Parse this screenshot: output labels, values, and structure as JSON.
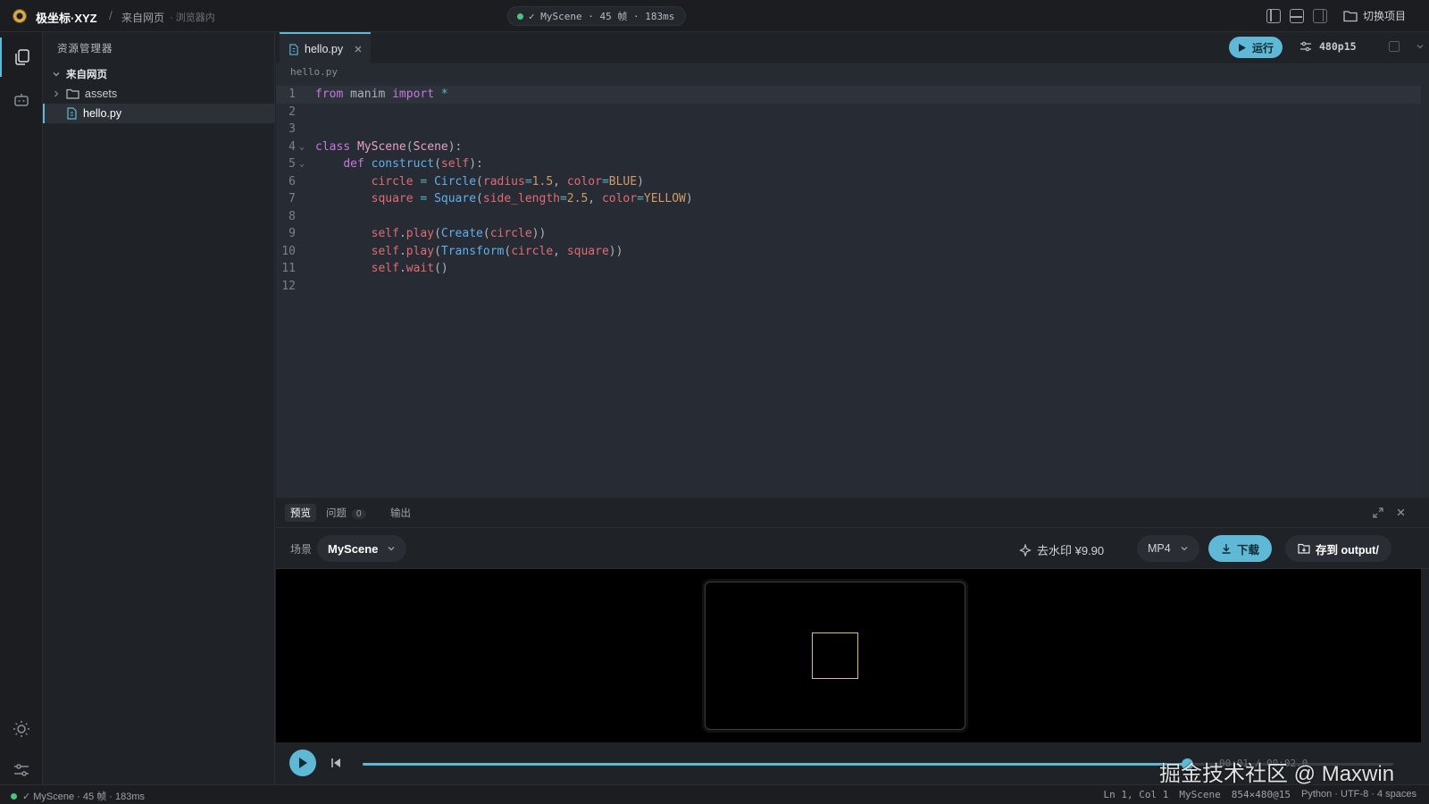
{
  "titlebar": {
    "app_title": "极坐标·XYZ",
    "breadcrumb_separator": "/",
    "breadcrumb_source": "来自网页",
    "breadcrumb_location": "· 浏览器内",
    "render_status": "✓ MyScene · 45 帧 · 183ms",
    "switch_project_label": "切换项目"
  },
  "explorer": {
    "title": "资源管理器",
    "root_folder": "来自网页",
    "items": [
      {
        "label": "assets",
        "type": "folder"
      },
      {
        "label": "hello.py",
        "type": "file"
      }
    ]
  },
  "editor": {
    "tab_label": "hello.py",
    "breadcrumb": "hello.py",
    "run_label": "运行",
    "quality_label": "480p15",
    "line_numbers": [
      "1",
      "2",
      "3",
      "4",
      "5",
      "6",
      "7",
      "8",
      "9",
      "10",
      "11",
      "12"
    ]
  },
  "panel": {
    "tabs": [
      {
        "label": "预览"
      },
      {
        "label": "问题",
        "badge": "0"
      },
      {
        "label": "输出"
      }
    ],
    "scene_label": "场景",
    "scene_value": "MyScene",
    "remove_watermark_label": "去水印 ¥9.90",
    "format_value": "MP4",
    "download_label": "下载",
    "save_label": "存到 output/",
    "progress_fraction": 0.8,
    "time_readout": "00:01 / 00:02.0"
  },
  "overlay_watermark": "掘金技术社区 @ Maxwin",
  "statusbar": {
    "left_status": "✓ MyScene · 45 帧 · 183ms",
    "cursor": "Ln 1, Col 1",
    "scene": "MyScene",
    "resolution": "854×480@15",
    "language": "Python · UTF-8 · 4 spaces"
  },
  "colors": {
    "accent": "#5fb8d6",
    "success": "#4cc37a",
    "shape_stroke": "#d8c168"
  },
  "icons": [
    "logo-icon",
    "layout-left-icon",
    "layout-bottom-icon",
    "layout-right-icon",
    "folder-open-icon",
    "files-icon",
    "robot-icon",
    "sun-icon",
    "sliders-icon",
    "chevron-down-icon",
    "chevron-right-icon",
    "folder-icon",
    "python-file-icon",
    "close-icon",
    "play-icon",
    "settings-icon",
    "maximize-icon",
    "sparkle-icon",
    "download-icon",
    "save-folder-icon",
    "skip-back-icon"
  ]
}
